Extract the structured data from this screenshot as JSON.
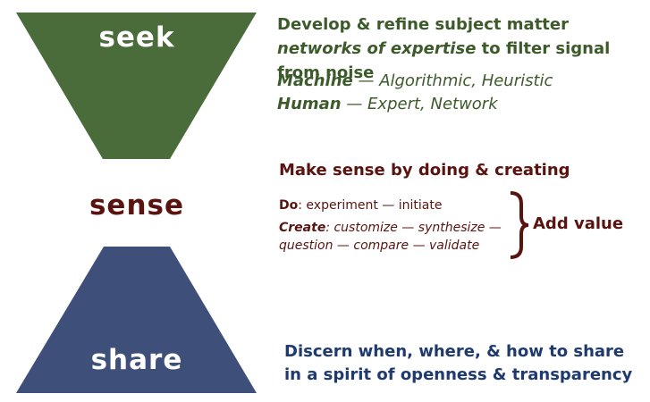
{
  "colors": {
    "seek": "#4a6b3a",
    "sense": "#5a1410",
    "share": "#3e5079",
    "seek_text": "#3d5a2b",
    "share_text": "#1e3a6e"
  },
  "seek": {
    "label": "seek",
    "heading_part1": "Develop & refine subject matter ",
    "heading_em": "networks of expertise",
    "heading_part2": " to filter signal from noise",
    "machine_label": "Machine",
    "machine_text": " — Algorithmic, Heuristic",
    "human_label": "Human",
    "human_text": " — Expert, Network"
  },
  "sense": {
    "label": "sense",
    "heading": "Make sense by doing & creating",
    "do_label": "Do",
    "do_text": ": experiment — initiate",
    "create_label": "Create",
    "create_text": ": customize — synthesize —",
    "create_text2": "question  — compare — validate",
    "add_value": "Add value"
  },
  "share": {
    "label": "share",
    "heading_line1": "Discern when, where, & how to share",
    "heading_line2": "in a spirit of openness & transparency"
  }
}
